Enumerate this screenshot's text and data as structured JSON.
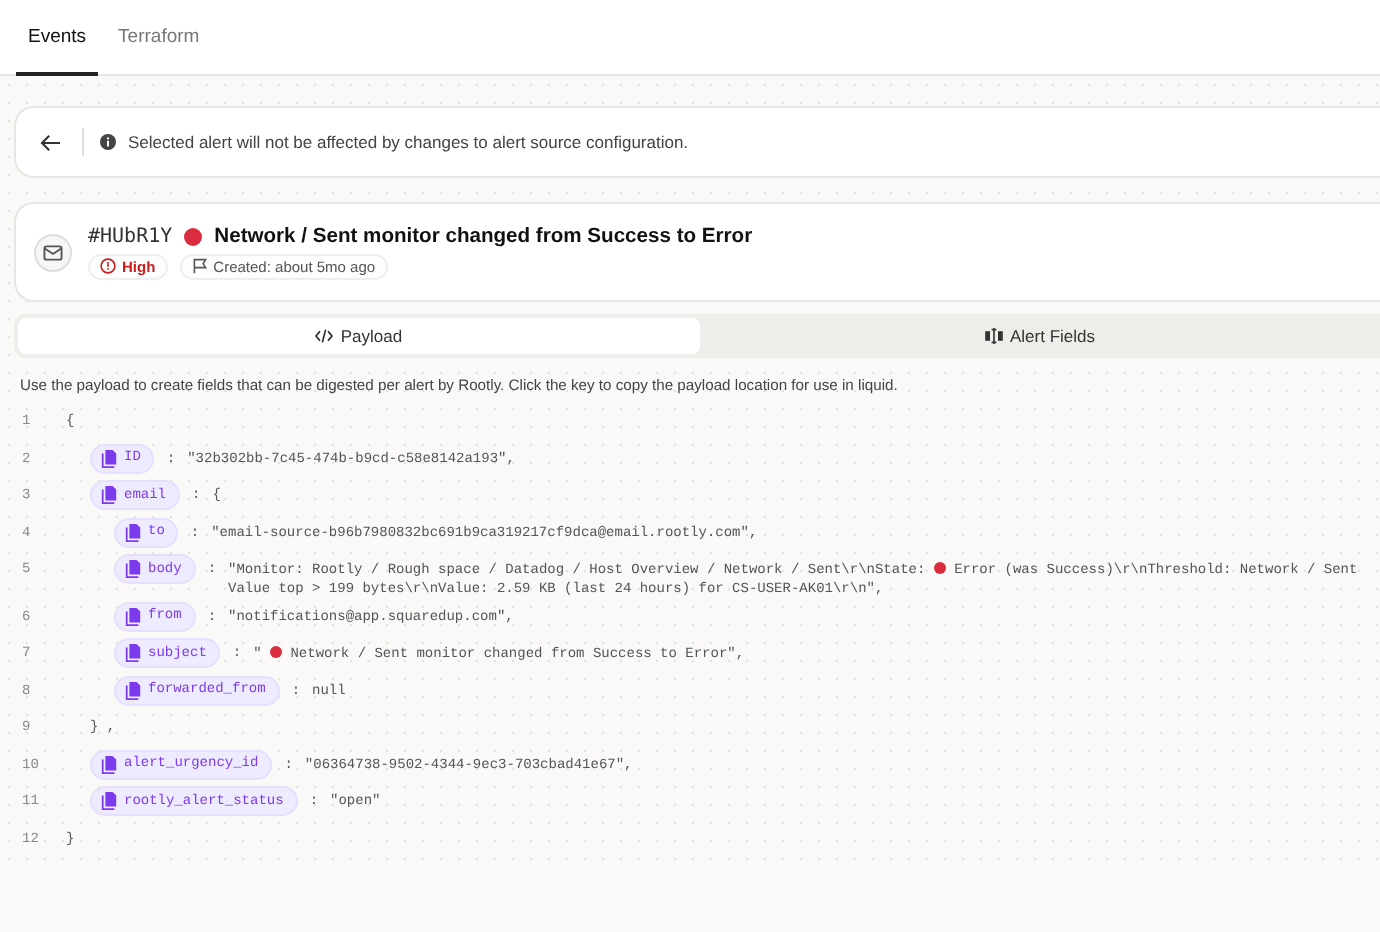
{
  "tabs": [
    {
      "label": "Events",
      "selected": true
    },
    {
      "label": "Terraform",
      "selected": false
    }
  ],
  "notice": {
    "text": "Selected alert will not be affected by changes to alert source configuration."
  },
  "alert": {
    "id": "#HUbR1Y",
    "title": "Network / Sent monitor changed from Success to Error",
    "severity": "High",
    "created": "Created: about 5mo ago"
  },
  "view_tabs": [
    {
      "kind": "code",
      "label": "Payload",
      "selected": true
    },
    {
      "kind": "fields",
      "label": "Alert Fields",
      "selected": false
    }
  ],
  "description": "Use the payload to create fields that can be digested per alert by Rootly. Click the key to copy the payload location for use in liquid.",
  "payload": {
    "line": "1",
    "open": "{",
    "close_line": "12",
    "close": "}",
    "fields": [
      {
        "line": "2",
        "key": "ID",
        "sep": ":",
        "value": "\"32b302bb-7c45-474b-b9cd-c58e8142a193\","
      },
      {
        "line": "3",
        "key": "email",
        "sep": ":",
        "value": "{",
        "close_line": "9",
        "close": "} ,",
        "children": [
          {
            "line": "4",
            "key": "to",
            "sep": ":",
            "value": "\"email-source-b96b7980832bc691b9ca319217cf9dca@email.rootly.com\","
          },
          {
            "line": "5",
            "key": "body",
            "sep": ":",
            "value": "\"Monitor: Rootly / Rough space / Datadog / Host Overview / Network / Sent\\r\\nState:",
            "value_after": "Error (was Success)\\r\\nThreshold: Network / Sent Value top > 199 bytes\\r\\nValue: 2.59 KB (last 24 hours) for CS-USER-AK01\\r\\n\","
          },
          {
            "line": "6",
            "key": "from",
            "sep": ":",
            "value": "\"notifications@app.squaredup.com\","
          },
          {
            "line": "7",
            "key": "subject",
            "sep": ":",
            "value": "\"",
            "value_after": "Network / Sent monitor changed from Success to Error\","
          },
          {
            "line": "8",
            "key": "forwarded_from",
            "sep": ":",
            "value": "null"
          }
        ]
      },
      {
        "line": "10",
        "key": "alert_urgency_id",
        "sep": ":",
        "value": "\"06364738-9502-4344-9ec3-703cbad41e67\","
      },
      {
        "line": "11",
        "key": "rootly_alert_status",
        "sep": ":",
        "value": "\"open\""
      }
    ]
  }
}
